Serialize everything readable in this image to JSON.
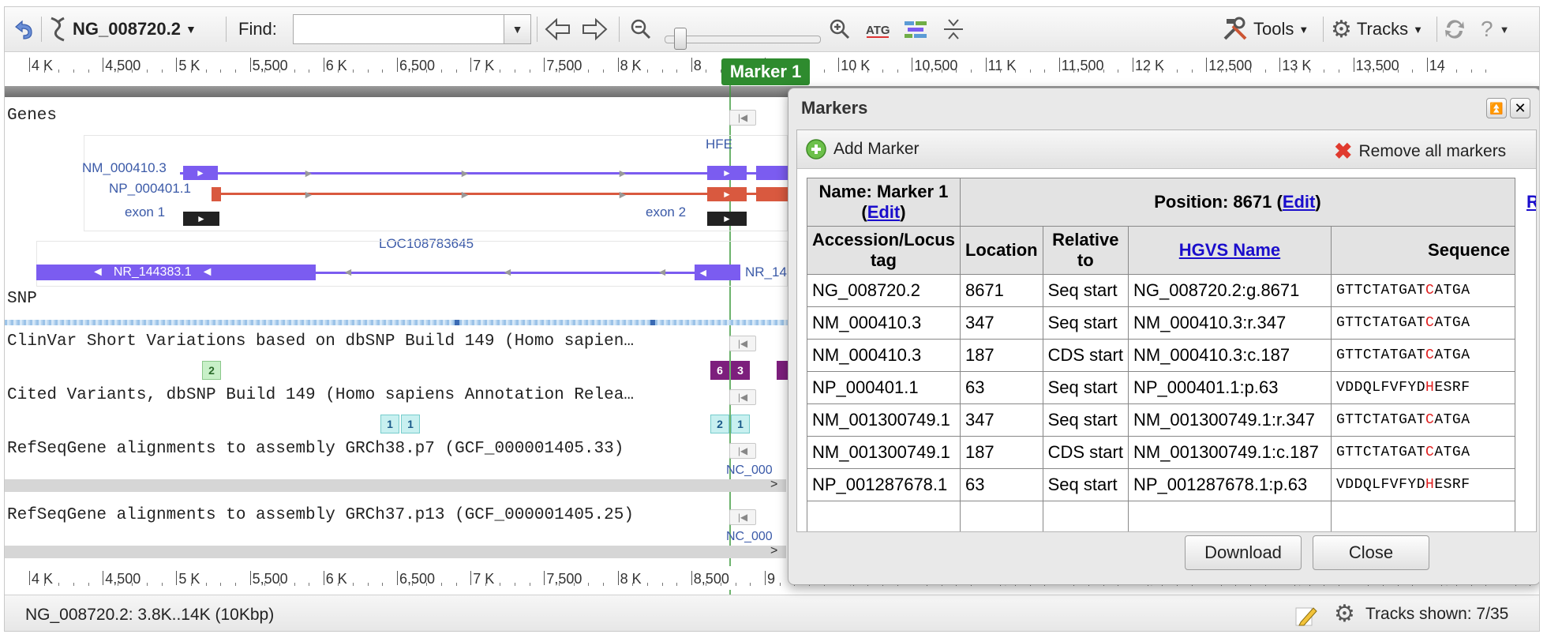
{
  "toolbar": {
    "sequence": "NG_008720.2",
    "find_label": "Find:",
    "find_value": "",
    "tools_label": "Tools",
    "tracks_label": "Tracks",
    "help_label": "?"
  },
  "ruler_top": [
    "4 K",
    "4,500",
    "5 K",
    "5,500",
    "6 K",
    "6,500",
    "7 K",
    "7,500",
    "8 K",
    "8",
    "9,500",
    "10 K",
    "10,500",
    "11 K",
    "11,500",
    "12 K",
    "12,500",
    "13 K",
    "13,500",
    "14"
  ],
  "ruler_bottom": [
    "4 K",
    "4,500",
    "5 K",
    "5,500",
    "6 K",
    "6,500",
    "7 K",
    "7,500",
    "8 K",
    "8,500",
    "9",
    "9,500",
    "10 K",
    "10,500",
    "11 K",
    "11,500",
    "12 K",
    "12,500",
    "13 K",
    "13,500",
    "14"
  ],
  "marker_flag": "Marker 1",
  "tracks": {
    "genes": "Genes",
    "snp": "SNP",
    "clinvar": "ClinVar Short Variations based on dbSNP Build 149 (Homo sapien…",
    "cited": "Cited Variants, dbSNP Build 149 (Homo sapiens Annotation Relea…",
    "refseq38": "RefSeqGene alignments to assembly GRCh38.p7 (GCF_000001405.33)",
    "refseq37": "RefSeqGene alignments to assembly GRCh37.p13 (GCF_000001405.25)"
  },
  "gene_labels": {
    "hfe": "HFE",
    "nm": "NM_000410.3",
    "np": "NP_000401.1",
    "exon1": "exon 1",
    "exon2": "exon 2",
    "loc": "LOC108783645",
    "nr": "NR_144383.1",
    "nr_cut": "NR_14",
    "nc1": "NC_000",
    "nc2": "NC_000"
  },
  "variants": {
    "clinvar_a": "2",
    "clinvar_b": "6",
    "clinvar_c": "3",
    "cited_a": "1",
    "cited_b": "1",
    "cited_c": "2",
    "cited_d": "1"
  },
  "status": {
    "range": "NG_008720.2: 3.8K..14K (10Kbp)",
    "tracks_shown": "Tracks shown: 7/35"
  },
  "dialog": {
    "title": "Markers",
    "add_marker": "Add Marker",
    "remove_all": "Remove all markers",
    "name_prefix": "Name: Marker 1",
    "name_edit": "Edit",
    "position_prefix": "Position: 8671 (",
    "position_edit": "Edit",
    "position_suffix": ")",
    "cut_link": "R",
    "headers": [
      "Accession/Locus tag",
      "Location",
      "Relative to",
      "HGVS Name",
      "Sequence"
    ],
    "rows": [
      {
        "acc": "NG_008720.2",
        "loc": "8671",
        "rel": "Seq start",
        "hgvs": "NG_008720.2:g.8671",
        "seq_pre": "GTTCTATGAT",
        "seq_hl": "C",
        "seq_post": "ATGA"
      },
      {
        "acc": "NM_000410.3",
        "loc": "347",
        "rel": "Seq start",
        "hgvs": "NM_000410.3:r.347",
        "seq_pre": "GTTCTATGAT",
        "seq_hl": "C",
        "seq_post": "ATGA"
      },
      {
        "acc": "NM_000410.3",
        "loc": "187",
        "rel": "CDS start",
        "hgvs": "NM_000410.3:c.187",
        "seq_pre": "GTTCTATGAT",
        "seq_hl": "C",
        "seq_post": "ATGA"
      },
      {
        "acc": "NP_000401.1",
        "loc": "63",
        "rel": "Seq start",
        "hgvs": "NP_000401.1:p.63",
        "seq_pre": "VDDQLFVFYD",
        "seq_hl": "H",
        "seq_post": "ESRF"
      },
      {
        "acc": "NM_001300749.1",
        "loc": "347",
        "rel": "Seq start",
        "hgvs": "NM_001300749.1:r.347",
        "seq_pre": "GTTCTATGAT",
        "seq_hl": "C",
        "seq_post": "ATGA"
      },
      {
        "acc": "NM_001300749.1",
        "loc": "187",
        "rel": "CDS start",
        "hgvs": "NM_001300749.1:c.187",
        "seq_pre": "GTTCTATGAT",
        "seq_hl": "C",
        "seq_post": "ATGA"
      },
      {
        "acc": "NP_001287678.1",
        "loc": "63",
        "rel": "Seq start",
        "hgvs": "NP_001287678.1:p.63",
        "seq_pre": "VDDQLFVFYD",
        "seq_hl": "H",
        "seq_post": "ESRF"
      }
    ],
    "download": "Download",
    "close": "Close"
  },
  "colors": {
    "transcript": "#7b5cf0",
    "protein": "#d9593f",
    "marker": "#2e8b2e",
    "clinvar_green": "#c8f0c8",
    "clinvar_purple": "#7d1f7d",
    "cited": "#c8f0f0"
  }
}
